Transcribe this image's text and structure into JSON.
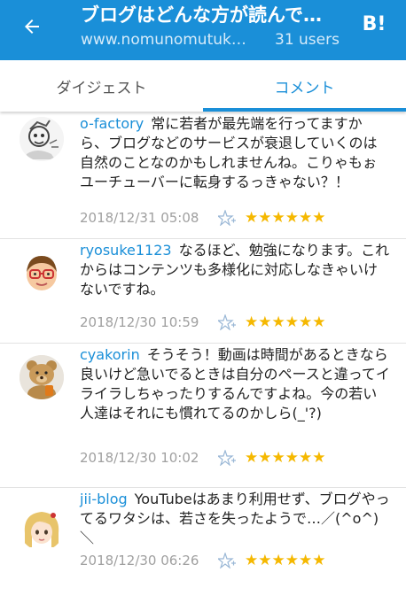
{
  "header": {
    "title": "ブログはどんな方が読んで…",
    "url": "www.nomunomutuk…",
    "users": "31 users",
    "b_label": "B!"
  },
  "tabs": [
    {
      "label": "ダイジェスト"
    },
    {
      "label": "コメント"
    }
  ],
  "comments": [
    {
      "user": "o-factory",
      "text": "常に若者が最先端を行ってますから、ブログなどのサービスが衰退していくのは自然のことなのかもしれませんね。こりゃもぉユーチューバーに転身するっきゃない？！",
      "date": "2018/12/31 05:08",
      "stars": "★★★★★★"
    },
    {
      "user": "ryosuke1123",
      "text": "なるほど、勉強になります。これからはコンテンツも多様化に対応しなきゃいけないですね。",
      "date": "2018/12/30 10:59",
      "stars": "★★★★★★"
    },
    {
      "user": "cyakorin",
      "text": "そうそう！動画は時間があるときなら良いけど急いでるときは自分のペースと違ってイライラしちゃったりするんですよね。今の若い人達はそれにも慣れてるのかしら(_'?)",
      "date": "2018/12/30 10:02",
      "stars": "★★★★★★"
    },
    {
      "user": "jii-blog",
      "text": "YouTubeはあまり利用せず、ブログやってるワタシは、若さを失ったようで…／(^o^)＼",
      "date": "2018/12/30 06:26",
      "stars": "★★★★★★"
    }
  ],
  "colors": {
    "accent": "#1a8fd8",
    "star": "#f5b800"
  }
}
